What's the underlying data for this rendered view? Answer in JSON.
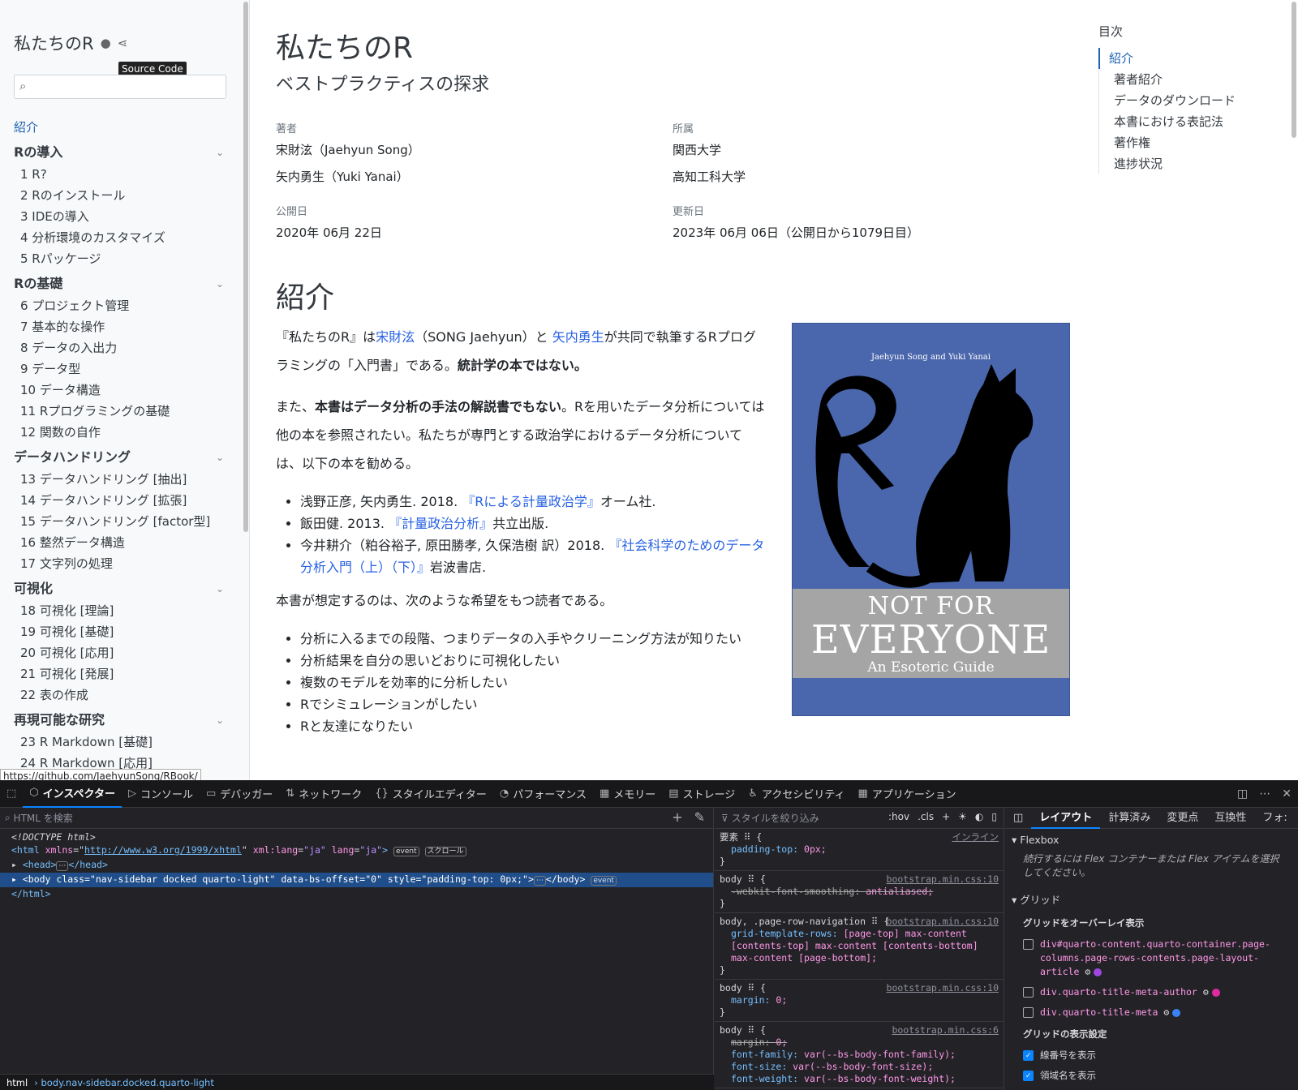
{
  "sidebar": {
    "title": "私たちのR",
    "tooltip": "Source Code",
    "search_placeholder": "",
    "top_item": "紹介",
    "sections": [
      {
        "label": "Rの導入",
        "items": [
          "1 R?",
          "2 Rのインストール",
          "3 IDEの導入",
          "4 分析環境のカスタマイズ",
          "5 Rパッケージ"
        ]
      },
      {
        "label": "Rの基礎",
        "items": [
          "6 プロジェクト管理",
          "7 基本的な操作",
          "8 データの入出力",
          "9 データ型",
          "10 データ構造",
          "11 Rプログラミングの基礎",
          "12 関数の自作"
        ]
      },
      {
        "label": "データハンドリング",
        "items": [
          "13 データハンドリング [抽出]",
          "14 データハンドリング [拡張]",
          "15 データハンドリング [factor型]",
          "16 整然データ構造",
          "17 文字列の処理"
        ]
      },
      {
        "label": "可視化",
        "items": [
          "18 可視化 [理論]",
          "19 可視化 [基礎]",
          "20 可視化 [応用]",
          "21 可視化 [発展]",
          "22 表の作成"
        ]
      },
      {
        "label": "再現可能な研究",
        "items": [
          "23 R Markdown [基礎]",
          "24 R Markdown [応用]"
        ]
      }
    ],
    "status_url": "https://github.com/JaehyunSong/RBook/"
  },
  "main": {
    "title": "私たちのR",
    "subtitle": "ベストプラクティスの探求",
    "authors_label": "著者",
    "affiliations_label": "所属",
    "author1": "宋財泫（Jaehyun Song）",
    "author2": "矢内勇生（Yuki Yanai）",
    "aff1": "関西大学",
    "aff2": "高知工科大学",
    "published_label": "公開日",
    "published": "2020年 06月 22日",
    "modified_label": "更新日",
    "modified": "2023年 06月 06日（公開日から1079日目）",
    "section_title": "紹介",
    "p1_a": "『私たちのR』は",
    "p1_link1": "宋財泫",
    "p1_b": "（SONG Jaehyun）と ",
    "p1_link2": "矢内勇生",
    "p1_c": "が共同で執筆するRプログラミングの「入門書」である。",
    "p1_bold": "統計学の本ではない。",
    "p2_a": "また、",
    "p2_bold": "本書はデータ分析の手法の解説書でもない",
    "p2_b": "。Rを用いたデータ分析については他の本を参照されたい。私たちが専門とする政治学におけるデータ分析については、以下の本を勧める。",
    "refs": [
      {
        "pre": "浅野正彦, 矢内勇生. 2018. ",
        "link": "『Rによる計量政治学』",
        "post": "オーム社."
      },
      {
        "pre": "飯田健. 2013. ",
        "link": "『計量政治分析』",
        "post": "共立出版."
      },
      {
        "pre": "今井耕介（粕谷裕子, 原田勝孝, 久保浩樹 訳）2018. ",
        "link": "『社会科学のためのデータ分析入門（上）（下）』",
        "post": "岩波書店."
      }
    ],
    "p3": "本書が想定するのは、次のような希望をもつ読者である。",
    "wishes": [
      "分析に入るまでの段階、つまりデータの入手やクリーニング方法が知りたい",
      "分析結果を自分の思いどおりに可視化したい",
      "複数のモデルを効率的に分析したい",
      "Rでシミュレーションがしたい",
      "Rと友達になりたい"
    ],
    "cover": {
      "authors": "Jaehyun Song and Yuki Yanai",
      "line1": "NOT FOR",
      "line2": "EVERYONE",
      "line3": "An Esoteric Guide",
      "bg": "#4a66ac"
    }
  },
  "toc": {
    "title": "目次",
    "items": [
      "紹介",
      "著者紹介",
      "データのダウンロード",
      "本書における表記法",
      "著作権",
      "進捗状況"
    ]
  },
  "devtools": {
    "tabs": [
      "インスペクター",
      "コンソール",
      "デバッガー",
      "ネットワーク",
      "スタイルエディター",
      "パフォーマンス",
      "メモリー",
      "ストレージ",
      "アクセシビリティ",
      "アプリケーション"
    ],
    "html_search_placeholder": "HTML を検索",
    "code": {
      "doctype": "<!DOCTYPE html>",
      "html_open": "<html",
      "xmlns_attr": "xmlns",
      "xmlns_val": "http://www.w3.org/1999/xhtml",
      "xml_lang": "xml:lang",
      "xml_lang_val": "\"ja\"",
      "lang": "lang",
      "lang_val": "\"ja\"",
      "badge_event": "event",
      "badge_scroll": "スクロール",
      "head": "<head>",
      "head_close": "</head>",
      "body_line": "<body class=\"nav-sidebar docked quarto-light\" data-bs-offset=\"0\" style=\"padding-top: 0px;\">",
      "body_close": "</body>",
      "html_close": "</html>"
    },
    "breadcrumb_html": "html",
    "breadcrumb_body": "body.nav-sidebar.docked.quarto-light",
    "styles_filter": "スタイルを絞り込み",
    "hov": ":hov",
    "cls": ".cls",
    "rules": [
      {
        "selector": "要素 ⠿ {",
        "src": "インライン",
        "props": [
          {
            "name": "padding-top",
            "value": "0px;"
          }
        ],
        "end": "}"
      },
      {
        "selector": "body ⠿ {",
        "src": "bootstrap.min.css:10",
        "props": [
          {
            "name": "-webkit-font-smoothing",
            "value": "antialiased;"
          }
        ],
        "end": "}"
      },
      {
        "selector": "body, .page-row-navigation ⠿ {",
        "src": "bootstrap.min.css:10",
        "props": [
          {
            "name": "grid-template-rows",
            "value": "[page-top] max-content [contents-top] max-content [contents-bottom] max-content [page-bottom];"
          }
        ],
        "end": "}"
      },
      {
        "selector": "body ⠿ {",
        "src": "bootstrap.min.css:10",
        "props": [
          {
            "name": "margin",
            "value": "0;"
          }
        ],
        "end": "}"
      },
      {
        "selector": "body ⠿ {",
        "src": "bootstrap.min.css:6",
        "props": [
          {
            "name": "margin",
            "value": "0;"
          },
          {
            "name": "font-family",
            "value": "var(--bs-body-font-family);"
          },
          {
            "name": "font-size",
            "value": "var(--bs-body-font-size);"
          },
          {
            "name": "font-weight",
            "value": "var(--bs-body-font-weight);"
          }
        ],
        "end": ""
      }
    ],
    "layout_tabs": [
      "レイアウト",
      "計算済み",
      "変更点",
      "互換性",
      "フォ:"
    ],
    "flexbox_label": "Flexbox",
    "flexbox_note": "続行するには Flex コンテナーまたは Flex アイテムを選択してください。",
    "grid_label": "グリッド",
    "grid_overlay_label": "グリッドをオーバーレイ表示",
    "grid_items": [
      {
        "label": "div#quarto-content.quarto-container.page-columns.page-rows-contents.page-layout-article",
        "color": "#a046e0"
      },
      {
        "label": "div.quarto-title-meta-author",
        "color": "#e02b9f"
      },
      {
        "label": "div.quarto-title-meta",
        "color": "#3b82f6"
      }
    ],
    "grid_settings_label": "グリッドの表示設定",
    "grid_settings": [
      "線番号を表示",
      "領域名を表示"
    ]
  }
}
